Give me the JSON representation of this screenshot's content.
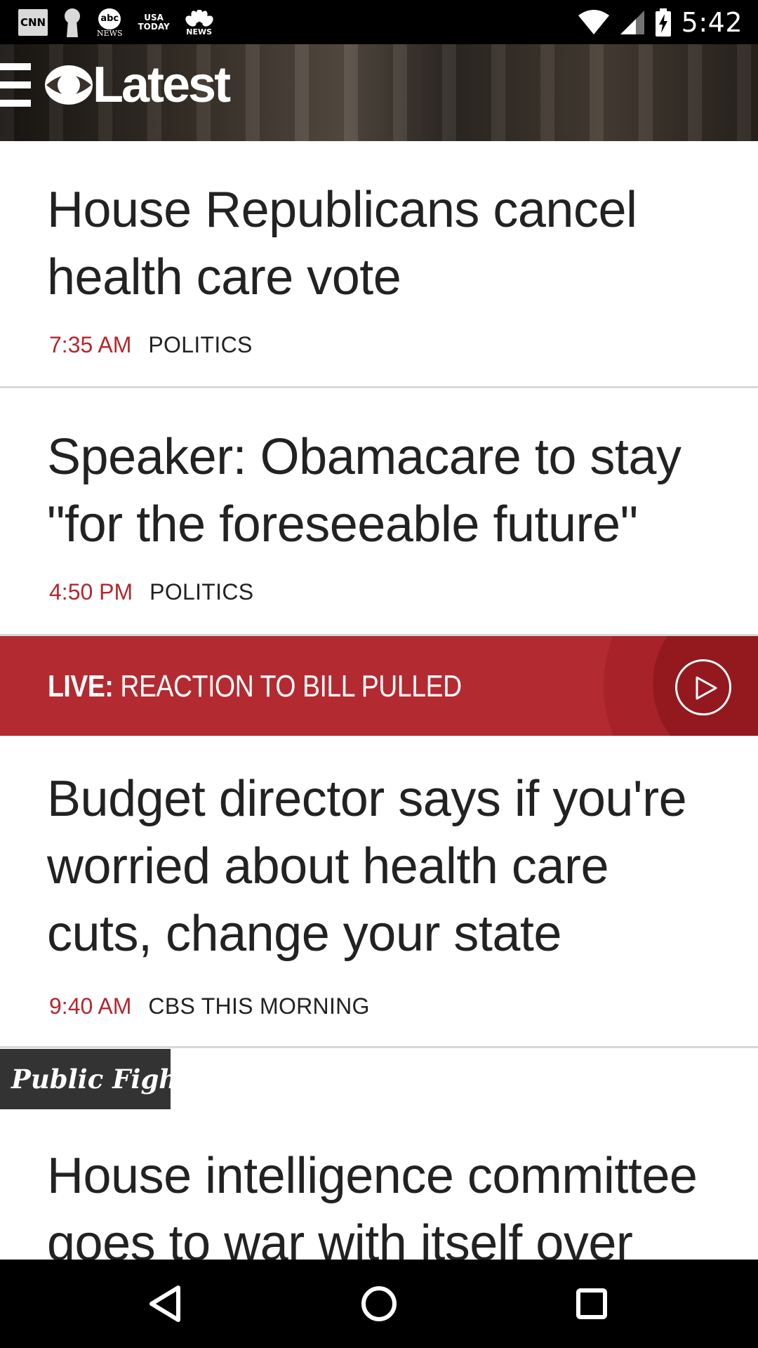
{
  "status_bar": {
    "time": "5:42",
    "notifications": [
      {
        "icon": "cnn-icon",
        "label": "CNN"
      },
      {
        "icon": "keyhole-icon"
      },
      {
        "icon": "abc-news-icon",
        "label": "abc",
        "sub": "NEWS"
      },
      {
        "icon": "usa-today-icon",
        "label": "USA",
        "sub": "TODAY"
      },
      {
        "icon": "nbc-news-icon",
        "sub": "NEWS"
      }
    ],
    "system_icons": [
      "wifi-icon",
      "cell-signal-icon",
      "battery-charging-icon"
    ]
  },
  "header": {
    "menu_icon": "hamburger-menu-icon",
    "logo_text": "Latest"
  },
  "stories": [
    {
      "title": "House Republicans cancel health care vote",
      "time": "7:35 AM",
      "category": "POLITICS"
    },
    {
      "title": "Speaker: Obamacare to stay \"for the foreseeable future\"",
      "time": "4:50 PM",
      "category": "POLITICS"
    },
    {
      "title": "Budget director says if you're worried about health care cuts, change your state",
      "time": "9:40 AM",
      "category": "CBS THIS MORNING"
    },
    {
      "title": "House intelligence committee goes to war with itself over"
    }
  ],
  "live_banner": {
    "label": "LIVE:",
    "text": "REACTION TO BILL PULLED",
    "icon": "play-icon"
  },
  "tag": "Public Fight",
  "colors": {
    "accent_red": "#b42a31",
    "time_red": "#b5272d",
    "tag_bg": "#333333"
  },
  "nav": [
    "back-icon",
    "home-icon",
    "recents-icon"
  ]
}
